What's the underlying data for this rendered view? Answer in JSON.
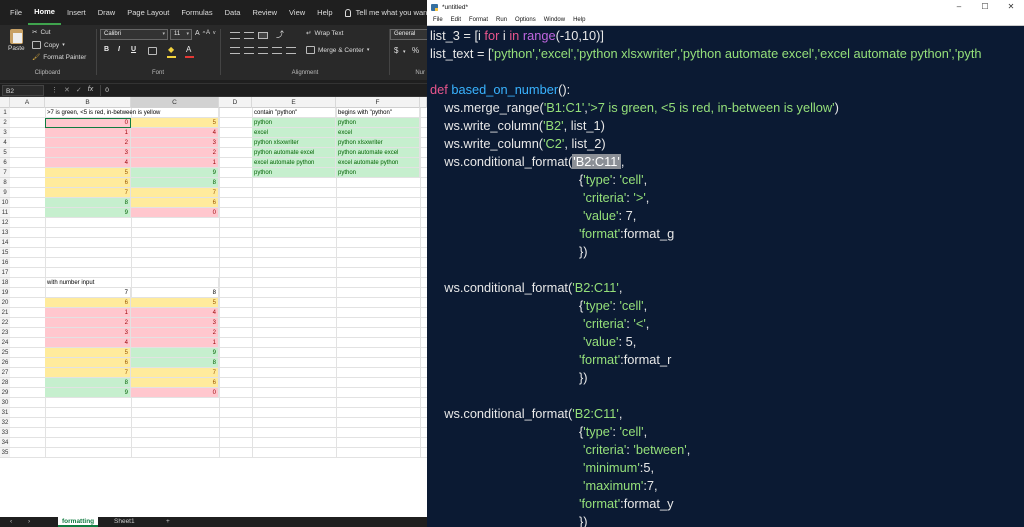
{
  "excel": {
    "menu": [
      "File",
      "Home",
      "Insert",
      "Draw",
      "Page Layout",
      "Formulas",
      "Data",
      "Review",
      "View",
      "Help"
    ],
    "active_tab": "Home",
    "tell_me": "Tell me what you want to do",
    "ribbon": {
      "paste": "Paste",
      "cut": "Cut",
      "copy": "Copy",
      "format_painter": "Format Painter",
      "clipboard": "Clipboard",
      "font_name": "Calibri",
      "font_size": "11",
      "bold": "B",
      "italic": "I",
      "underline": "U",
      "font_group": "Font",
      "wrap_text": "Wrap Text",
      "merge_center": "Merge & Center",
      "alignment": "Alignment",
      "number_format": "General",
      "currency": "$",
      "percent": "%",
      "number_group": "Nur"
    },
    "name_box": "B2",
    "formula_value": "0",
    "columns": [
      "A",
      "B",
      "C",
      "D",
      "E",
      "F"
    ],
    "rows": [
      "1",
      "2",
      "3",
      "4",
      "5",
      "6",
      "7",
      "8",
      "9",
      "10",
      "11",
      "12",
      "13",
      "14",
      "15",
      "16",
      "17",
      "18",
      "19",
      "20",
      "21",
      "22",
      "23",
      "24",
      "25",
      "26",
      "27",
      "28",
      "29",
      "30",
      "31",
      "32",
      "33",
      "34",
      "35"
    ],
    "title1": ">7 is green, <5 is red, in-between is yellow",
    "block1": [
      [
        "0",
        "5"
      ],
      [
        "1",
        "4"
      ],
      [
        "2",
        "3"
      ],
      [
        "3",
        "2"
      ],
      [
        "4",
        "1"
      ],
      [
        "5",
        "9"
      ],
      [
        "6",
        "8"
      ],
      [
        "7",
        "7"
      ],
      [
        "8",
        "6"
      ],
      [
        "9",
        "0"
      ]
    ],
    "e_header": "contain \"python\"",
    "f_header": "begins with \"python\"",
    "text_list": [
      "python",
      "excel",
      "python xlsxwriter",
      "python automate excel",
      "excel automate python",
      "python"
    ],
    "title2": "with number input",
    "block2": [
      [
        "7",
        "8"
      ],
      [
        "6",
        "5"
      ],
      [
        "1",
        "4"
      ],
      [
        "2",
        "3"
      ],
      [
        "3",
        "2"
      ],
      [
        "4",
        "1"
      ],
      [
        "5",
        "9"
      ],
      [
        "6",
        "8"
      ],
      [
        "7",
        "7"
      ],
      [
        "8",
        "6"
      ],
      [
        "9",
        "0"
      ]
    ],
    "sheets": [
      "formatting",
      "Sheet1"
    ],
    "active_sheet": "formatting",
    "add_sheet": "+"
  },
  "idle": {
    "title": "*untitled*",
    "menu": [
      "File",
      "Edit",
      "Format",
      "Run",
      "Options",
      "Window",
      "Help"
    ],
    "code": {
      "l1a": "list_3 = [i ",
      "l1b": "for",
      "l1c": " i ",
      "l1d": "in",
      "l1e": " ",
      "l1f": "range",
      "l1g": "(-10,10)]",
      "l2a": "list_text = [",
      "l2b": "'python','excel','python xlsxwriter','python automate excel','excel automate python','pyth",
      "l3a": "def",
      "l3b": " ",
      "l3c": "based_on_number",
      "l3d": "():",
      "l4a": "    ws.merge_range(",
      "l4b": "'B1:C1'",
      "l4c": ",",
      "l4d": "'>7 is green, <5 is red, in-between is yellow'",
      "l4e": ")",
      "l5a": "    ws.write_column(",
      "l5b": "'B2'",
      "l5c": ", list_1)",
      "l6a": "    ws.write_column(",
      "l6b": "'C2'",
      "l6c": ", list_2)",
      "l7a": "    ws.conditional_format(",
      "l7b": "'B2:C11'",
      "l7c": ",",
      "c1a": "{",
      "c1b": "'type'",
      "c1c": ": ",
      "c1d": "'cell'",
      "c1e": ",",
      "c2a": "'criteria'",
      "c2b": ": ",
      "c2c": "'>'",
      "c2d": ",",
      "c3a": "'value'",
      "c3b": ": 7,",
      "c4a": "'format'",
      "c4b": ":format_g",
      "c5": "})",
      "l14a": "    ws.conditional_format(",
      "l14b": "'B2:C11'",
      "l14c": ",",
      "d1a": "{",
      "d1b": "'type'",
      "d1c": ": ",
      "d1d": "'cell'",
      "d1e": ",",
      "d2a": "'criteria'",
      "d2b": ": ",
      "d2c": "'<'",
      "d2d": ",",
      "d3a": "'value'",
      "d3b": ": 5,",
      "d4a": "'format'",
      "d4b": ":format_r",
      "d5": "})",
      "l21a": "    ws.conditional_format(",
      "l21b": "'B2:C11'",
      "l21c": ",",
      "e1a": "{",
      "e1b": "'type'",
      "e1c": ": ",
      "e1d": "'cell'",
      "e1e": ",",
      "e2a": "'criteria'",
      "e2b": ": ",
      "e2c": "'between'",
      "e2d": ",",
      "e3a": "'minimum'",
      "e3b": ":5,",
      "e4a": "'maximum'",
      "e4b": ":7,",
      "e5a": "'format'",
      "e5b": ":format_y",
      "e6": "})"
    }
  },
  "colors": {
    "keyword": "#e8558c",
    "function": "#39b3ff",
    "builtin": "#c067e0",
    "string": "#95e07a",
    "editor_bg": "#0b1a33",
    "green_fill": "#c6efce",
    "red_fill": "#ffc7ce",
    "yellow_fill": "#ffeb9c"
  }
}
